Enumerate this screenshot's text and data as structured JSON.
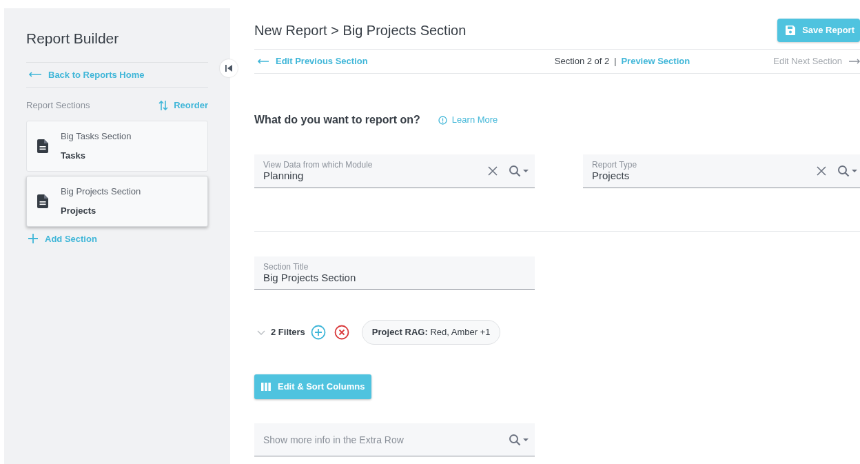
{
  "sidebar": {
    "title": "Report Builder",
    "back_link": "Back to Reports Home",
    "sections_label": "Report Sections",
    "reorder": "Reorder",
    "sections": [
      {
        "name": "Big Tasks Section",
        "type": "Tasks",
        "selected": false
      },
      {
        "name": "Big Projects Section",
        "type": "Projects",
        "selected": true
      }
    ],
    "add_section": "Add Section"
  },
  "header": {
    "title": "New Report > Big Projects Section",
    "save_button": "Save Report"
  },
  "nav": {
    "previous": "Edit Previous Section",
    "position": "Section 2 of 2",
    "separator": "|",
    "preview": "Preview Section",
    "next": {
      "label": "Edit Next Section",
      "disabled": true
    }
  },
  "question": {
    "text": "What do you want to report on?",
    "learn_more": "Learn More"
  },
  "fields": [
    {
      "label": "View Data from which Module",
      "value": "Planning"
    },
    {
      "label": "Report Type",
      "value": "Projects"
    }
  ],
  "section_title": {
    "label": "Section Title",
    "value": "Big Projects Section"
  },
  "filters": {
    "expanded": false,
    "count": "2 Filters",
    "chips": [
      "**Project RAG:** Red, Amber +1"
    ]
  },
  "columns_button": "Edit & Sort Columns",
  "extra_row": {
    "placeholder": "Show more info in the Extra Row"
  }
}
